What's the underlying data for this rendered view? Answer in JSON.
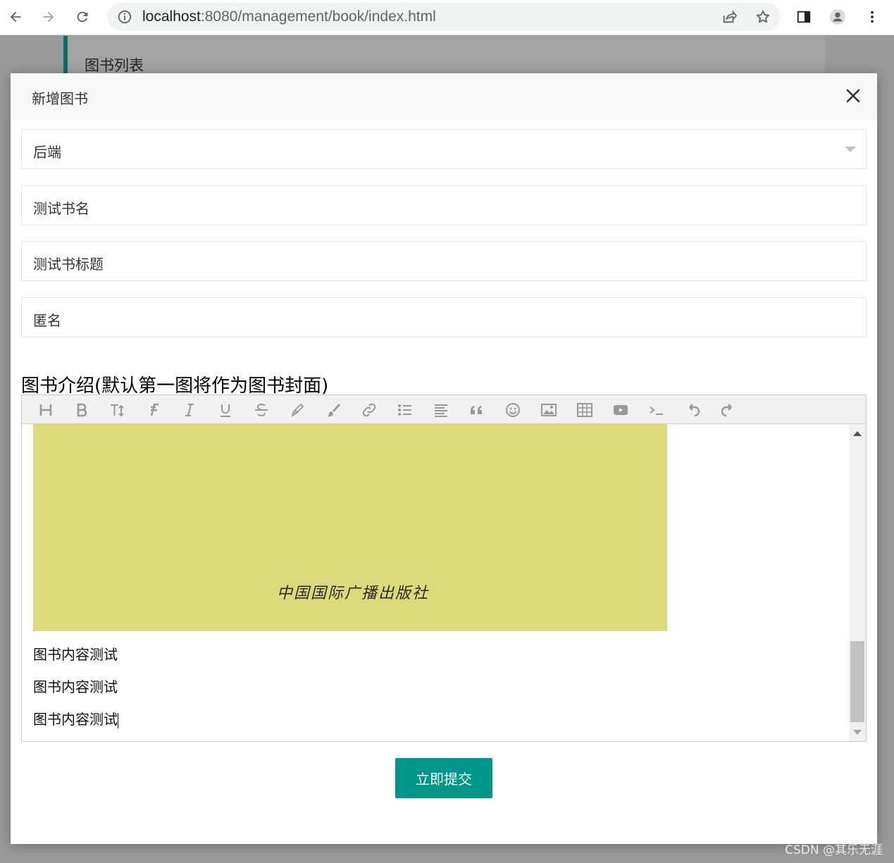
{
  "browser": {
    "url_host": "localhost",
    "url_rest": ":8080/management/book/index.html"
  },
  "page": {
    "panel_title": "图书列表"
  },
  "modal": {
    "title": "新增图书",
    "category_value": "后端",
    "book_name_value": "测试书名",
    "book_title_value": "测试书标题",
    "author_value": "匿名",
    "intro_label": "图书介绍(默认第一图将作为图书封面)",
    "toolbar_icons": [
      "heading-icon",
      "bold-icon",
      "font-size-icon",
      "font-family-icon",
      "italic-icon",
      "underline-icon",
      "strikethrough-icon",
      "text-color-icon",
      "background-color-icon",
      "link-icon",
      "list-icon",
      "align-icon",
      "quote-icon",
      "emoticon-icon",
      "image-icon",
      "table-icon",
      "video-icon",
      "code-icon",
      "undo-icon",
      "redo-icon"
    ],
    "editor": {
      "cover_text": "中国国际广播出版社",
      "paragraphs": [
        "图书内容测试",
        "图书内容测试",
        "图书内容测试"
      ]
    },
    "submit_label": "立即提交"
  },
  "watermark": "CSDN @其乐无涯",
  "colors": {
    "accent": "#009688",
    "panel_border": "#0d6e63",
    "cover": "#dcdb7c"
  }
}
